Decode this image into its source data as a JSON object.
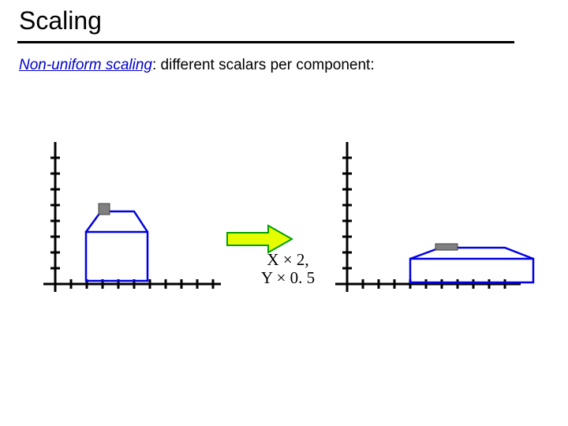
{
  "title": "Scaling",
  "subtitle_term": "Non-uniform scaling",
  "subtitle_rest": ": different scalars per component:",
  "formula_line1": "X × 2,",
  "formula_line2": "Y × 0. 5",
  "colors": {
    "house_stroke": "#0000e0",
    "arrow_fill": "#e6ff00",
    "arrow_stroke": "#00a000",
    "chimney_fill": "#808080"
  },
  "chart_data": {
    "type": "diagram",
    "title": "Non-uniform scaling",
    "description": "Two coordinate axes. Left axes show a house shape of roughly width 3 and height 3 starting near x=2 y=0. Right axes show the same house after scaling X by 2 and Y by 0.5, so it is twice as wide and half as tall.",
    "left_shape_bbox": {
      "x": 2,
      "y": 0,
      "w": 3,
      "h": 3,
      "units": "ticks"
    },
    "right_shape_bbox": {
      "x": 4,
      "y": 0,
      "w": 6,
      "h": 1.5,
      "units": "ticks"
    },
    "transform": {
      "sx": 2,
      "sy": 0.5
    },
    "ticks": {
      "x_count": 10,
      "y_count": 8,
      "spacing": "equal"
    }
  }
}
